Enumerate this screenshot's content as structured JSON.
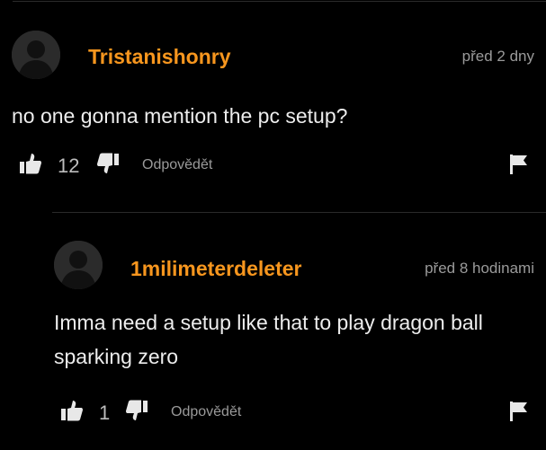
{
  "comments": [
    {
      "username": "Tristanishonry",
      "timestamp": "před 2 dny",
      "text": "no one gonna mention the pc setup?",
      "likes": "12",
      "reply_label": "Odpovědět"
    }
  ],
  "replies": [
    {
      "username": "1milimeterdeleter",
      "timestamp": "před 8 hodinami",
      "text": "Imma need a setup like that to play dragon ball sparking zero",
      "likes": "1",
      "reply_label": "Odpovědět"
    }
  ],
  "icons": {
    "like": "thumbs-up-icon",
    "dislike": "thumbs-down-icon",
    "flag": "flag-icon",
    "avatar": "user-silhouette-icon"
  },
  "colors": {
    "background": "#000000",
    "username": "#f7961e",
    "text": "#ededed",
    "muted": "#9a9a9a",
    "icon": "#e8e8e8"
  }
}
